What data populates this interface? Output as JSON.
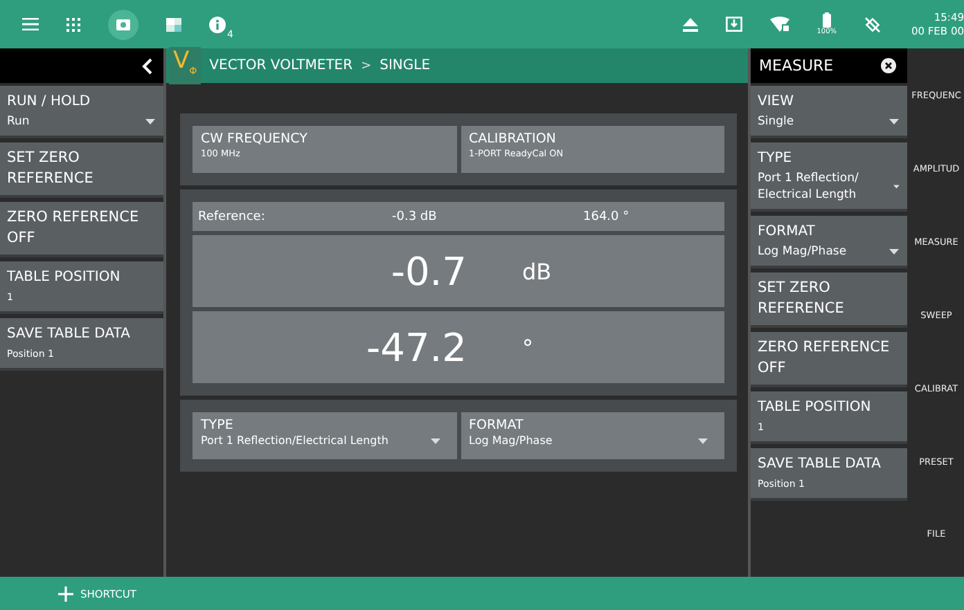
{
  "status_bar": {
    "info_count": "4",
    "battery": "100%",
    "time": "15:49",
    "date": "00 FEB 00"
  },
  "breadcrumb": {
    "logo": "V",
    "logo_sub": "Φ",
    "parts": [
      "VECTOR VOLTMETER",
      "SINGLE"
    ],
    "separator": ">"
  },
  "left_menu": [
    {
      "label": "RUN / HOLD",
      "value": "Run",
      "kind": "dropdown"
    },
    {
      "label": "SET ZERO REFERENCE",
      "kind": "button"
    },
    {
      "label": "ZERO REFERENCE OFF",
      "kind": "button"
    },
    {
      "label": "TABLE POSITION",
      "value": "1",
      "kind": "value"
    },
    {
      "label": "SAVE TABLE DATA",
      "value": "Position 1",
      "kind": "value"
    }
  ],
  "settings_top": [
    {
      "label": "CW FREQUENCY",
      "value": "100 MHz"
    },
    {
      "label": "CALIBRATION",
      "value": "1-PORT ReadyCal ON"
    }
  ],
  "reference": {
    "label": "Reference:",
    "magnitude": "-0.3 dB",
    "phase": "164.0 °"
  },
  "readings": [
    {
      "value": "-0.7",
      "unit": "dB"
    },
    {
      "value": "-47.2",
      "unit": "°"
    }
  ],
  "settings_bottom": [
    {
      "label": "TYPE",
      "value": "Port 1 Reflection/Electrical Length"
    },
    {
      "label": "FORMAT",
      "value": "Log Mag/Phase"
    }
  ],
  "measure_panel": {
    "title": "MEASURE",
    "items": [
      {
        "label": "VIEW",
        "value": "Single",
        "kind": "dropdown"
      },
      {
        "label": "TYPE",
        "value": "Port 1 Reflection/ Electrical Length",
        "kind": "dropdown"
      },
      {
        "label": "FORMAT",
        "value": "Log Mag/Phase",
        "kind": "dropdown"
      },
      {
        "label": "SET ZERO REFERENCE",
        "kind": "button"
      },
      {
        "label": "ZERO REFERENCE OFF",
        "kind": "button"
      },
      {
        "label": "TABLE POSITION",
        "value": "1",
        "kind": "value"
      },
      {
        "label": "SAVE TABLE DATA",
        "value": "Position 1",
        "kind": "value"
      }
    ]
  },
  "side_menu": [
    "FREQUENC",
    "AMPLITUD",
    "MEASURE",
    "SWEEP",
    "CALIBRAT",
    "PRESET",
    "FILE"
  ],
  "shortcut": {
    "label": "SHORTCUT"
  }
}
